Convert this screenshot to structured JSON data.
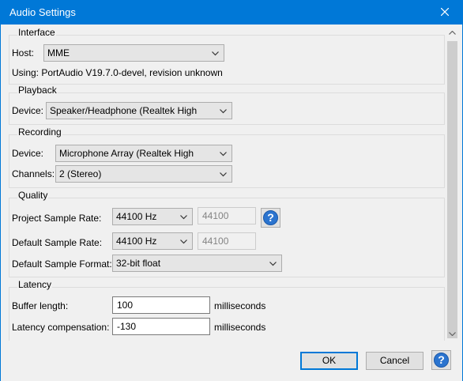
{
  "window": {
    "title": "Audio Settings"
  },
  "interface": {
    "label": "Interface",
    "host_label": "Host:",
    "host_value": "MME",
    "using_text": "Using: PortAudio V19.7.0-devel, revision unknown"
  },
  "playback": {
    "label": "Playback",
    "device_label": "Device:",
    "device_value": "Speaker/Headphone (Realtek High"
  },
  "recording": {
    "label": "Recording",
    "device_label": "Device:",
    "device_value": "Microphone Array (Realtek High",
    "channels_label": "Channels:",
    "channels_value": "2 (Stereo)"
  },
  "quality": {
    "label": "Quality",
    "project_rate_label": "Project Sample Rate:",
    "project_rate_value": "44100 Hz",
    "project_rate_field": "44100",
    "default_rate_label": "Default Sample Rate:",
    "default_rate_value": "44100 Hz",
    "default_rate_field": "44100",
    "format_label": "Default Sample Format:",
    "format_value": "32-bit float"
  },
  "latency": {
    "label": "Latency",
    "buffer_label": "Buffer length:",
    "buffer_value": "100",
    "buffer_unit": "milliseconds",
    "compensation_label": "Latency compensation:",
    "compensation_value": "-130",
    "compensation_unit": "milliseconds"
  },
  "buttons": {
    "ok": "OK",
    "cancel": "Cancel",
    "help": "?"
  },
  "colors": {
    "titlebar": "#0078d7",
    "help_icon": "#2b74cf"
  }
}
